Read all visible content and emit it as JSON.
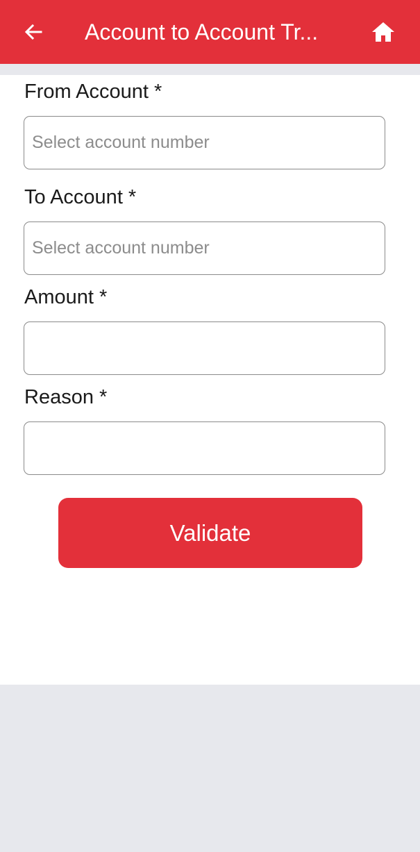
{
  "header": {
    "title": "Account to Account Tr...",
    "back_icon": "arrow-left-icon",
    "home_icon": "home-icon",
    "background_color": "#e3303a"
  },
  "form": {
    "from_account": {
      "label": "From Account *",
      "placeholder": "Select account number",
      "value": ""
    },
    "to_account": {
      "label": "To Account *",
      "placeholder": "Select account number",
      "value": ""
    },
    "amount": {
      "label": "Amount *",
      "placeholder": "",
      "value": ""
    },
    "reason": {
      "label": "Reason *",
      "placeholder": "",
      "value": ""
    },
    "validate_label": "Validate"
  },
  "colors": {
    "accent": "#e3303a",
    "page_background": "#e7e8ed",
    "card_background": "#ffffff"
  }
}
